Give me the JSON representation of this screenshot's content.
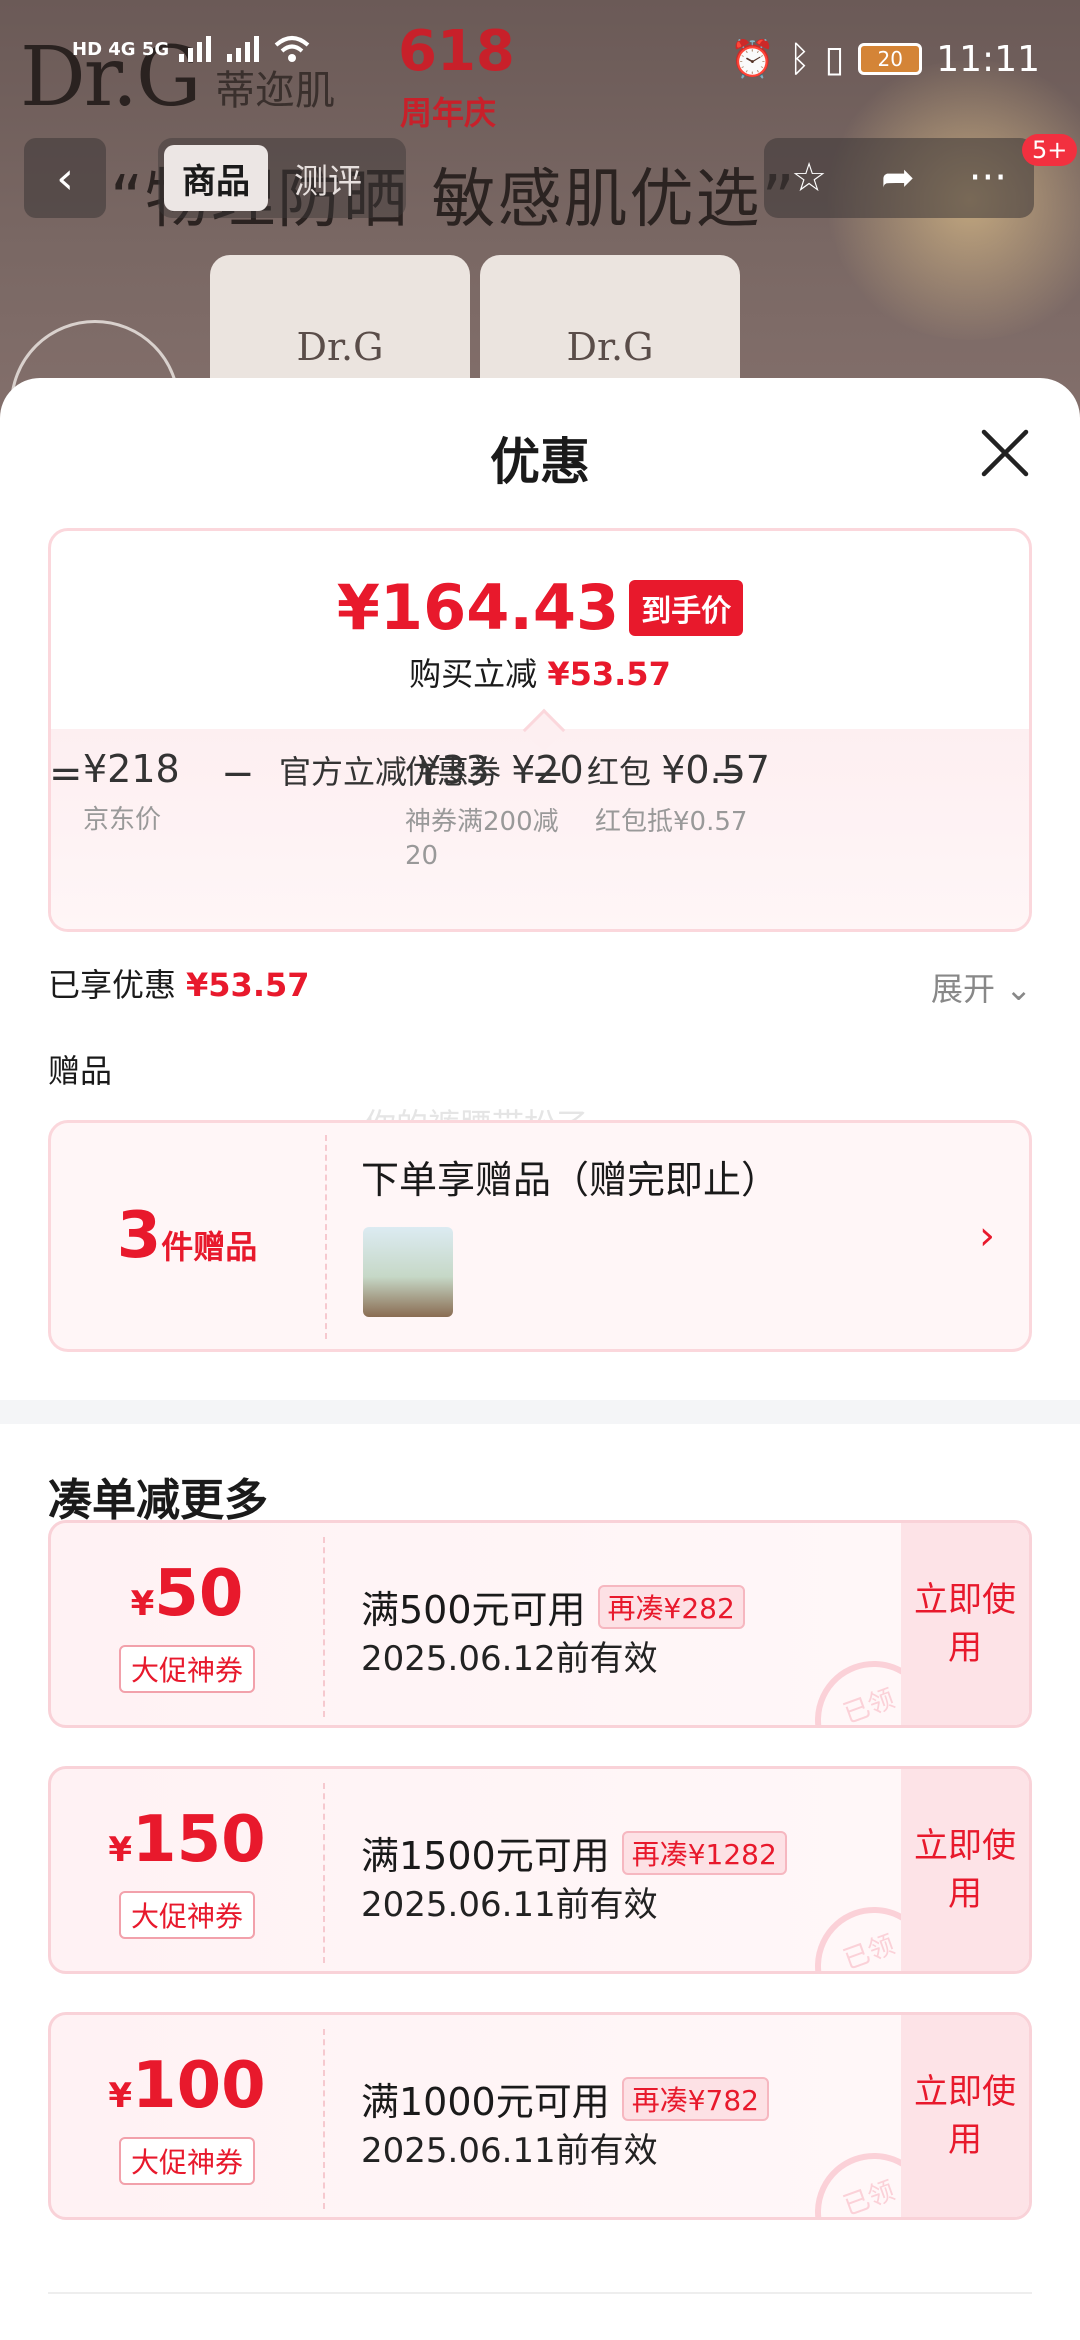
{
  "status_bar": {
    "left_indicators": "HD 4G 5G",
    "time": "11:11",
    "battery": "20"
  },
  "background": {
    "brand": "Dr.G",
    "brand_cn": "蒂迩肌",
    "campaign_num": "618",
    "campaign_text": "周年庆",
    "slogan": "“物理防晒 敏感肌优选”",
    "tube_label": "Dr.G"
  },
  "nav": {
    "tabs": [
      {
        "label": "商品"
      },
      {
        "label": "测评"
      }
    ],
    "badge": "5+"
  },
  "sheet": {
    "title": "优惠",
    "price_card": {
      "price": "¥164.43",
      "price_tag": "到手价",
      "instant_label": "购买立减",
      "instant_amount": "¥53.57",
      "breakdown": [
        {
          "label": "",
          "amount": "¥218",
          "desc": "京东价"
        },
        {
          "label": "官方立减",
          "amount": "¥33",
          "desc": ""
        },
        {
          "label": "优惠券",
          "amount": "¥20",
          "desc": "神券满200减20"
        },
        {
          "label": "红包",
          "amount": "¥0.57",
          "desc": "红包抵¥0.57"
        }
      ],
      "op_equal": "=",
      "op_minus": "−"
    },
    "enjoyed_label": "已享优惠",
    "enjoyed_amount": "¥53.57",
    "expand_label": "展开",
    "gift_section_title": "赠品",
    "watermark": "你的裤腰带松了",
    "gift": {
      "count": "3",
      "count_label": "件赠品",
      "headline": "下单享赠品（赠完即止）"
    },
    "more_title": "凑单减更多",
    "coupons": [
      {
        "yen": "¥",
        "amount": "50",
        "type": "大促神券",
        "condition": "满500元可用",
        "need": "再凑¥282",
        "validity": "2025.06.12前有效",
        "action": "立即使用",
        "stamp": "已领"
      },
      {
        "yen": "¥",
        "amount": "150",
        "type": "大促神券",
        "condition": "满1500元可用",
        "need": "再凑¥1282",
        "validity": "2025.06.11前有效",
        "action": "立即使用",
        "stamp": "已领"
      },
      {
        "yen": "¥",
        "amount": "100",
        "type": "大促神券",
        "condition": "满1000元可用",
        "need": "再凑¥782",
        "validity": "2025.06.11前有效",
        "action": "立即使用",
        "stamp": "已领"
      }
    ]
  },
  "colors": {
    "accent": "#e8192c",
    "card_border": "#fbd7dc"
  }
}
